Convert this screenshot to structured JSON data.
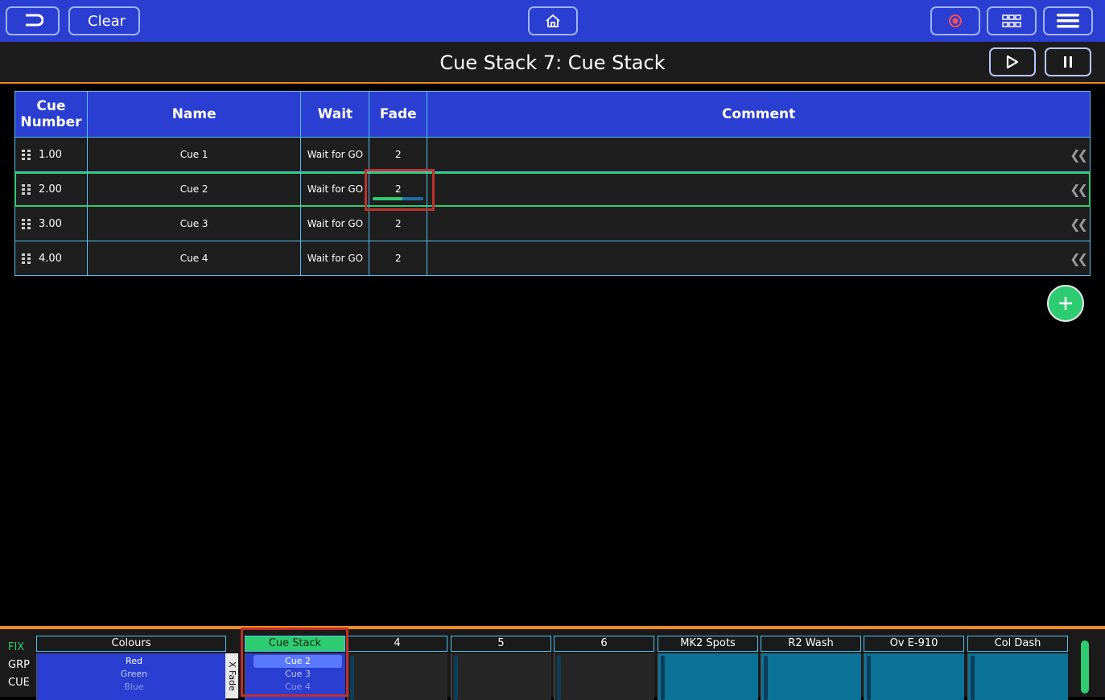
{
  "topbar": {
    "back_icon": "back-arrow-icon",
    "clear_label": "Clear",
    "home_icon": "home-icon",
    "record_icon": "record-icon",
    "grid_icon": "grid-view-icon",
    "menu_icon": "hamburger-menu-icon"
  },
  "title": "Cue Stack 7: Cue Stack",
  "transport": {
    "play_icon": "play-icon",
    "pause_icon": "pause-icon"
  },
  "table": {
    "headers": {
      "cue_number": "Cue Number",
      "name": "Name",
      "wait": "Wait",
      "fade": "Fade",
      "comment": "Comment"
    },
    "rows": [
      {
        "number": "1.00",
        "name": "Cue 1",
        "wait": "Wait for GO",
        "fade": "2",
        "comment": "",
        "selected": false,
        "fade_progress": null
      },
      {
        "number": "2.00",
        "name": "Cue 2",
        "wait": "Wait for GO",
        "fade": "2",
        "comment": "",
        "selected": true,
        "fade_progress": 0.58
      },
      {
        "number": "3.00",
        "name": "Cue 3",
        "wait": "Wait for GO",
        "fade": "2",
        "comment": "",
        "selected": false,
        "fade_progress": null
      },
      {
        "number": "4.00",
        "name": "Cue 4",
        "wait": "Wait for GO",
        "fade": "2",
        "comment": "",
        "selected": false,
        "fade_progress": null
      }
    ]
  },
  "bottom": {
    "side_labels": [
      {
        "label": "FIX",
        "active": true
      },
      {
        "label": "GRP",
        "active": false
      },
      {
        "label": "CUE",
        "active": false
      }
    ],
    "xfade_label": "X Fade",
    "playbacks": [
      {
        "title": "Colours",
        "items": [
          "Red",
          "Green",
          "Blue"
        ]
      },
      {
        "title": "Cue Stack",
        "items": [
          "Cue 2",
          "Cue 3",
          "Cue 4"
        ]
      },
      {
        "title": "4"
      },
      {
        "title": "5"
      },
      {
        "title": "6"
      },
      {
        "title": "MK2 Spots"
      },
      {
        "title": "R2 Wash"
      },
      {
        "title": "Ov E-910"
      },
      {
        "title": "Col Dash"
      }
    ]
  },
  "colors": {
    "accent_blue": "#2a3ed1",
    "accent_green": "#2ecc71",
    "accent_orange": "#f08a24",
    "highlight_red": "#c0302c",
    "teal": "#0a7297"
  }
}
